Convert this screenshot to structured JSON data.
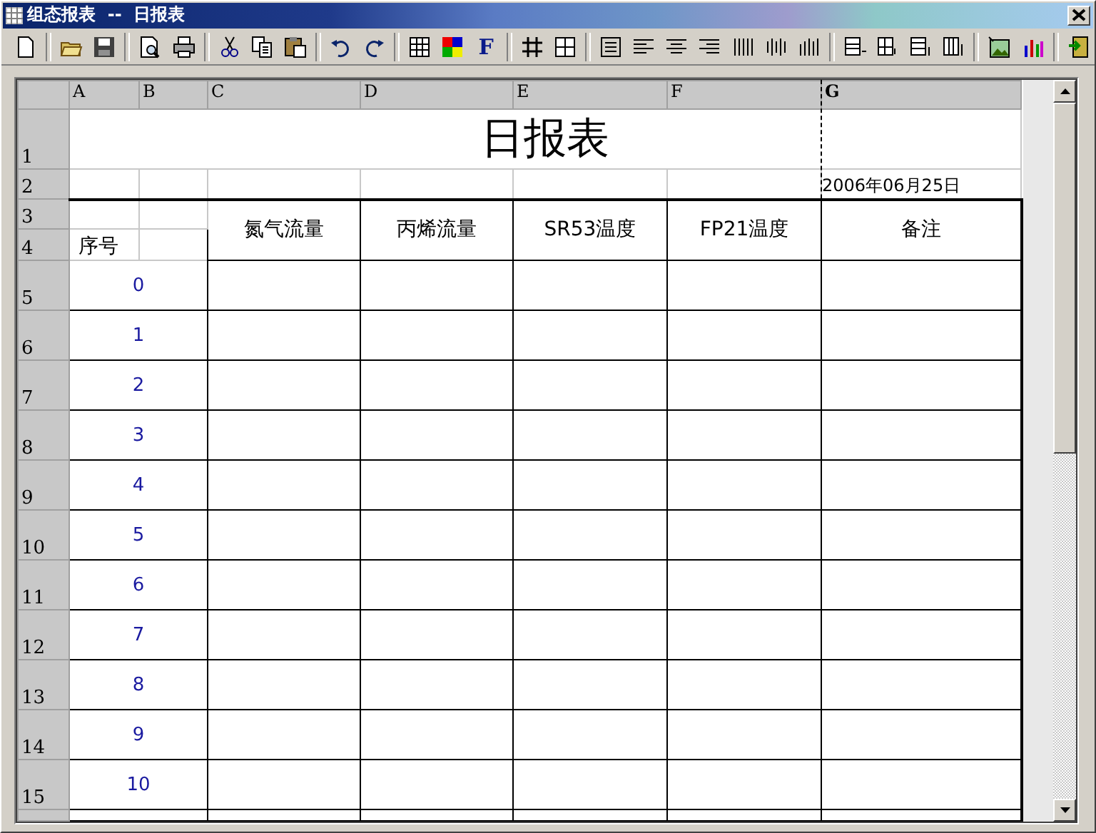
{
  "window": {
    "title": "组态报表  --  日报表"
  },
  "toolbar": {
    "font_button": "F"
  },
  "sheet": {
    "column_headers": [
      "A",
      "B",
      "C",
      "D",
      "E",
      "F",
      "G"
    ],
    "row_headers": [
      "1",
      "2",
      "3",
      "4",
      "5",
      "6",
      "7",
      "8",
      "9",
      "10",
      "11",
      "12",
      "13",
      "14",
      "15"
    ],
    "title": "日报表",
    "date": "2006年06月25日",
    "index_heading": "序号",
    "columns": [
      "氮气流量",
      "丙烯流量",
      "SR53温度",
      "FP21温度",
      "备注"
    ],
    "rows": [
      {
        "index": "0"
      },
      {
        "index": "1"
      },
      {
        "index": "2"
      },
      {
        "index": "3"
      },
      {
        "index": "4"
      },
      {
        "index": "5"
      },
      {
        "index": "6"
      },
      {
        "index": "7"
      },
      {
        "index": "8"
      },
      {
        "index": "9"
      },
      {
        "index": "10"
      }
    ]
  }
}
